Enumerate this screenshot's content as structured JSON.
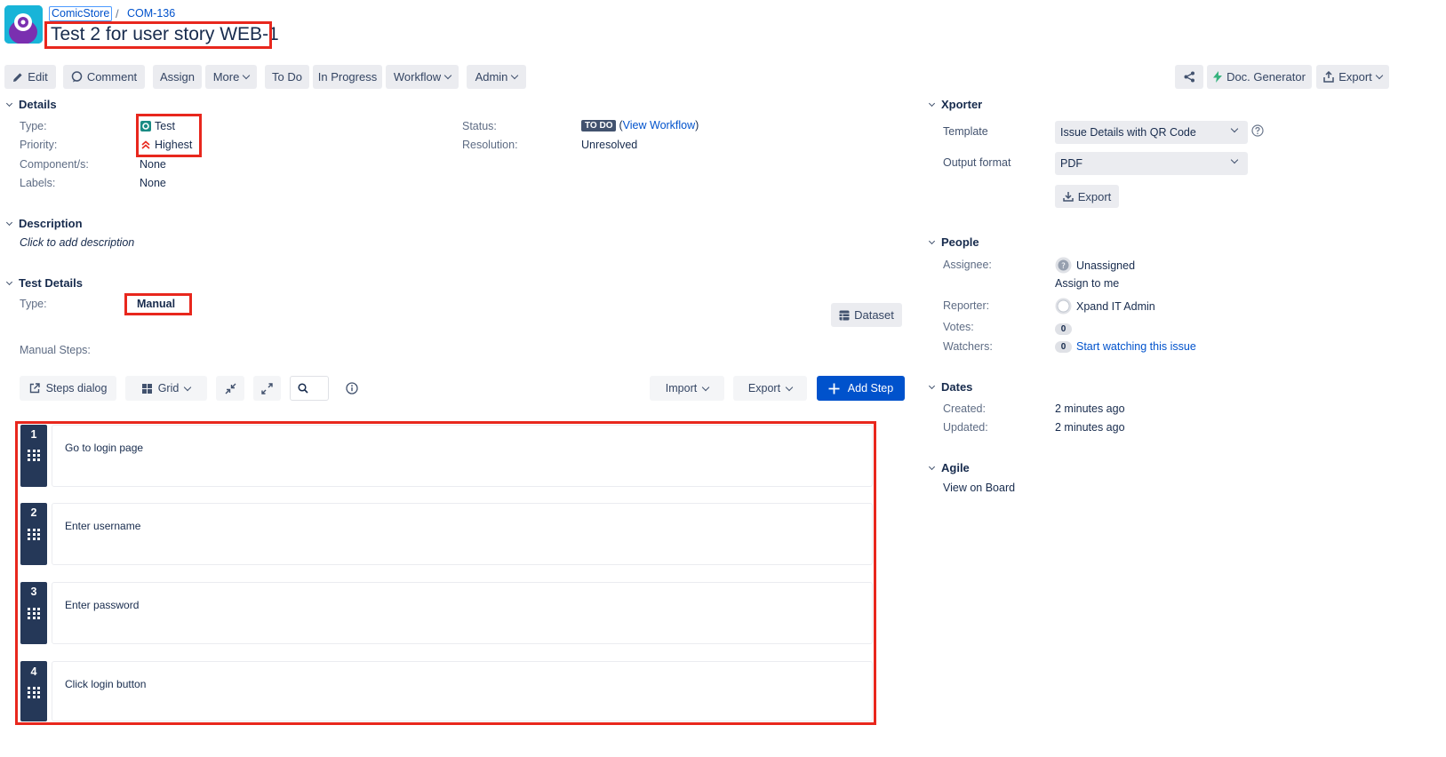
{
  "breadcrumb": {
    "project": "ComicStore",
    "separator": "/",
    "issue_key": "COM-136"
  },
  "issue": {
    "title": "Test 2 for user story WEB-1"
  },
  "toolbar": {
    "edit": "Edit",
    "comment": "Comment",
    "assign": "Assign",
    "more": "More",
    "todo": "To Do",
    "in_progress": "In Progress",
    "workflow": "Workflow",
    "admin": "Admin",
    "doc_generator": "Doc. Generator",
    "export": "Export"
  },
  "details": {
    "heading": "Details",
    "type_label": "Type:",
    "type_value": "Test",
    "priority_label": "Priority:",
    "priority_value": "Highest",
    "components_label": "Component/s:",
    "components_value": "None",
    "labels_label": "Labels:",
    "labels_value": "None",
    "status_label": "Status:",
    "status_value": "TO DO",
    "view_workflow_open": "(",
    "view_workflow": "View Workflow",
    "view_workflow_close": ")",
    "resolution_label": "Resolution:",
    "resolution_value": "Unresolved"
  },
  "description": {
    "heading": "Description",
    "placeholder": "Click to add description"
  },
  "test_details": {
    "heading": "Test Details",
    "type_label": "Type:",
    "type_value": "Manual",
    "dataset_button": "Dataset",
    "manual_steps_label": "Manual Steps:"
  },
  "steps_toolbar": {
    "steps_dialog": "Steps dialog",
    "grid": "Grid",
    "import": "Import",
    "export": "Export",
    "add_step": "Add Step"
  },
  "steps": [
    {
      "number": "1",
      "action": "Go to login page"
    },
    {
      "number": "2",
      "action": "Enter username"
    },
    {
      "number": "3",
      "action": "Enter password"
    },
    {
      "number": "4",
      "action": "Click login button"
    }
  ],
  "xporter": {
    "heading": "Xporter",
    "template_label": "Template",
    "template_value": "Issue Details with QR Code",
    "output_label": "Output format",
    "output_value": "PDF",
    "export_button": "Export"
  },
  "people": {
    "heading": "People",
    "assignee_label": "Assignee:",
    "assignee_value": "Unassigned",
    "assign_to_me": "Assign to me",
    "reporter_label": "Reporter:",
    "reporter_value": "Xpand IT Admin",
    "votes_label": "Votes:",
    "votes_value": "0",
    "watchers_label": "Watchers:",
    "watchers_value": "0",
    "start_watching": "Start watching this issue"
  },
  "dates": {
    "heading": "Dates",
    "created_label": "Created:",
    "created_value": "2 minutes ago",
    "updated_label": "Updated:",
    "updated_value": "2 minutes ago"
  },
  "agile": {
    "heading": "Agile",
    "view_on_board": "View on Board"
  },
  "colors": {
    "primary": "#0052cc",
    "highlight": "#e8271d",
    "step_badge": "#253858",
    "button_bg": "#ebecf0"
  }
}
